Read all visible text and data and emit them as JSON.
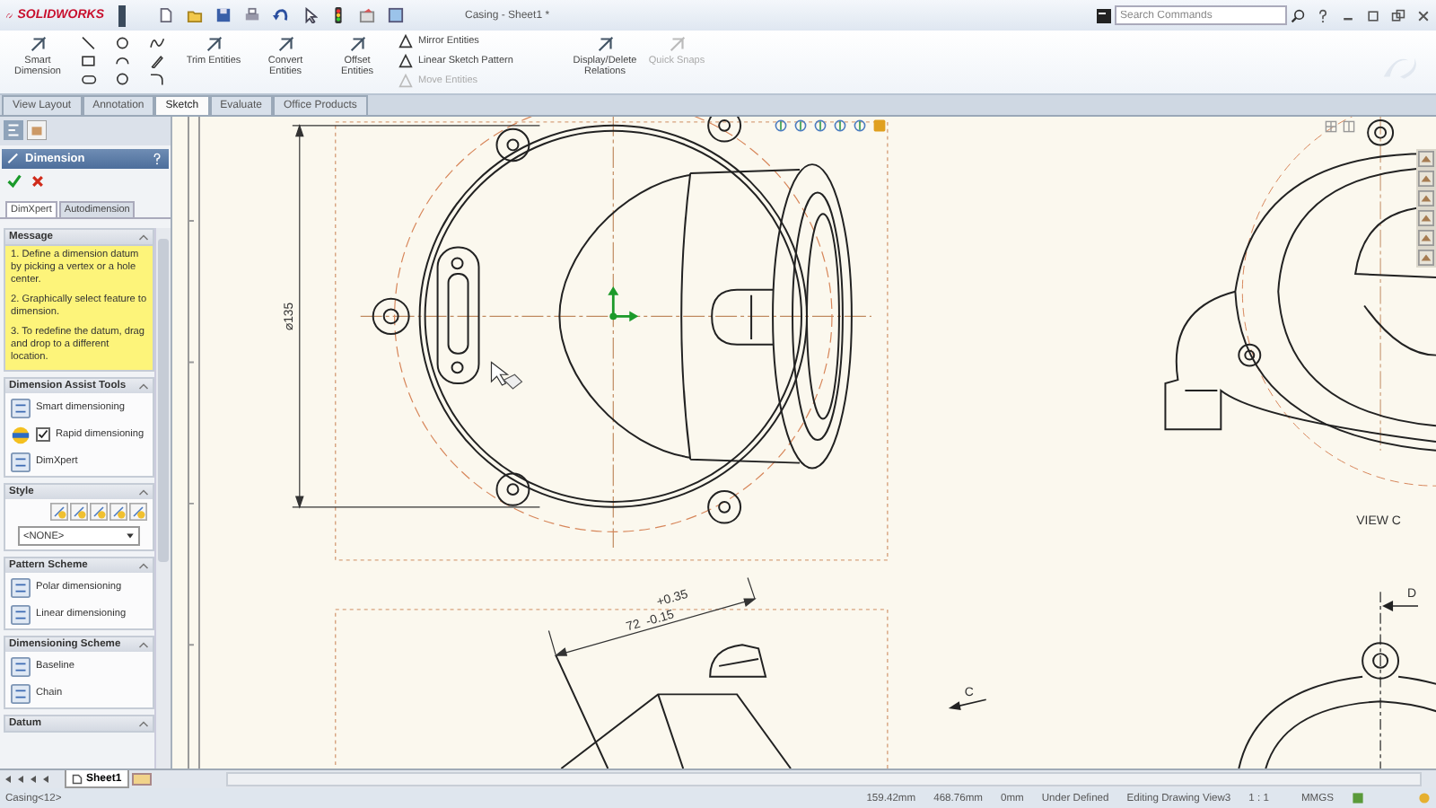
{
  "app": {
    "name": "SOLIDWORKS"
  },
  "window": {
    "title": "Casing - Sheet1 *"
  },
  "search": {
    "placeholder": "Search Commands"
  },
  "ribbon": {
    "groups": [
      {
        "kind": "big",
        "label": "Smart Dimension",
        "disabled": false
      },
      {
        "kind": "sketch_grid"
      },
      {
        "kind": "big",
        "label": "Trim Entities",
        "disabled": false
      },
      {
        "kind": "big",
        "label": "Convert Entities",
        "disabled": false
      },
      {
        "kind": "big",
        "label": "Offset Entities",
        "disabled": false
      },
      {
        "kind": "list",
        "items": [
          {
            "label": "Mirror Entities",
            "disabled": false
          },
          {
            "label": "Linear Sketch Pattern",
            "disabled": false
          },
          {
            "label": "Move Entities",
            "disabled": true
          }
        ]
      },
      {
        "kind": "big",
        "label": "Display/Delete Relations",
        "disabled": false
      },
      {
        "kind": "big",
        "label": "Quick Snaps",
        "disabled": true
      }
    ]
  },
  "tabs": [
    {
      "label": "View Layout",
      "selected": false
    },
    {
      "label": "Annotation",
      "selected": false
    },
    {
      "label": "Sketch",
      "selected": true
    },
    {
      "label": "Evaluate",
      "selected": false
    },
    {
      "label": "Office Products",
      "selected": false
    }
  ],
  "property_manager": {
    "title": "Dimension",
    "tabs": [
      {
        "label": "DimXpert",
        "selected": true
      },
      {
        "label": "Autodimension",
        "selected": false
      }
    ],
    "sections": [
      {
        "title": "Message",
        "kind": "message",
        "paragraphs": [
          "1. Define a dimension datum by picking a vertex or a hole center.",
          "2. Graphically select feature to dimension.",
          "3. To redefine the datum, drag and drop to a different location."
        ]
      },
      {
        "title": "Dimension Assist Tools",
        "kind": "tools",
        "items": [
          {
            "kind": "tool",
            "label": "Smart dimensioning"
          },
          {
            "kind": "checkbox",
            "label": "Rapid dimensioning",
            "checked": true
          },
          {
            "kind": "tool",
            "label": "DimXpert"
          }
        ]
      },
      {
        "title": "Style",
        "kind": "style",
        "value": "<NONE>"
      },
      {
        "title": "Pattern Scheme",
        "kind": "tools",
        "items": [
          {
            "kind": "tool",
            "label": "Polar dimensioning"
          },
          {
            "kind": "tool",
            "label": "Linear dimensioning"
          }
        ]
      },
      {
        "title": "Dimensioning Scheme",
        "kind": "tools",
        "items": [
          {
            "kind": "tool",
            "label": "Baseline"
          },
          {
            "kind": "tool",
            "label": "Chain"
          }
        ]
      },
      {
        "title": "Datum",
        "kind": "tools"
      }
    ]
  },
  "drawing": {
    "diameter_dimension": "⌀135",
    "tolerance_upper": "+0.35",
    "length_dimension": "72",
    "tolerance_lower": "-0.15",
    "section_arrow_label": "C",
    "view_label": "VIEW C",
    "detail_arrow_label": "D"
  },
  "sheet_tabs": [
    {
      "label": "Sheet1",
      "selected": true
    }
  ],
  "status_bar": {
    "document": "Casing<12>",
    "items": [
      "159.42mm",
      "468.76mm",
      "0mm",
      "Under Defined",
      "Editing Drawing View3",
      "1 : 1"
    ],
    "units": "MMGS"
  }
}
